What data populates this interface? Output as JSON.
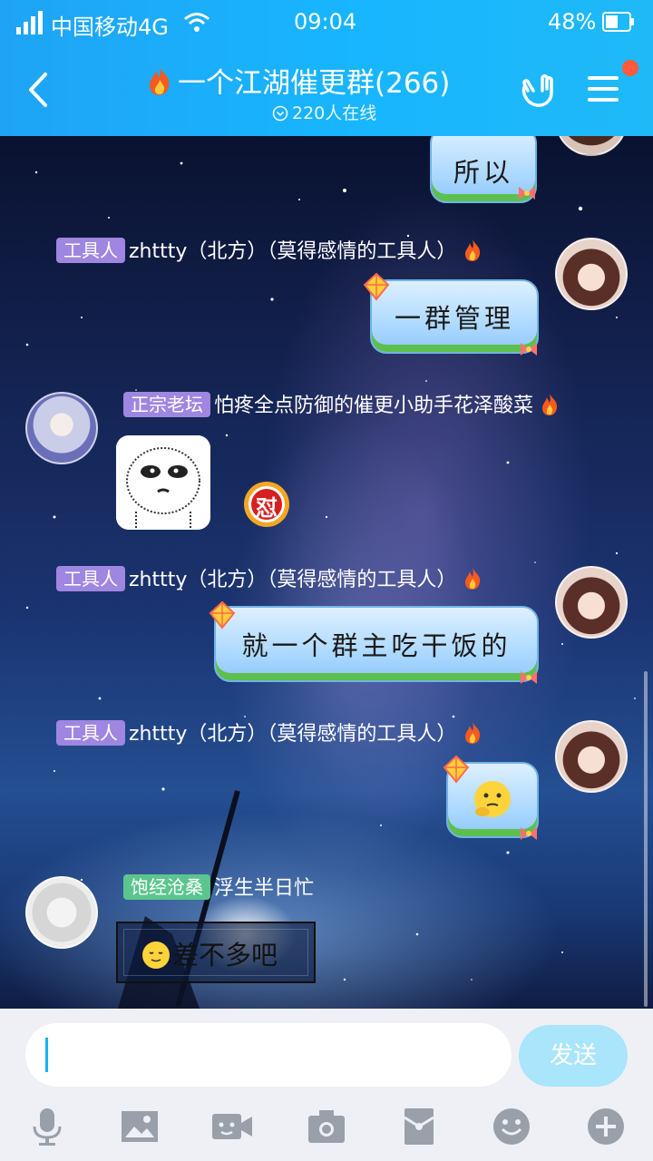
{
  "status_bar": {
    "carrier": "中国移动4G",
    "time": "09:04",
    "battery": "48%"
  },
  "header": {
    "title": "一个江湖催更群(266)",
    "online": "220人在线"
  },
  "messages": {
    "m0_text": "所以",
    "m1": {
      "tag": "工具人",
      "nick": "zhttty（北方）（莫得感情的工具人）",
      "text": "一群管理"
    },
    "m2": {
      "tag": "正宗老坛",
      "nick": "怕疼全点防御的催更小助手花泽酸菜",
      "badge": "怼"
    },
    "m3": {
      "tag": "工具人",
      "nick": "zhttty（北方）（莫得感情的工具人）",
      "text": "就一个群主吃干饭的"
    },
    "m4": {
      "tag": "工具人",
      "nick": "zhttty（北方）（莫得感情的工具人）"
    },
    "m5": {
      "tag": "饱经沧桑",
      "nick": "浮生半日忙",
      "text": "差不多吧"
    }
  },
  "input": {
    "send_label": "发送",
    "value": ""
  },
  "toolbar": [
    "mic-icon",
    "image-icon",
    "video-call-icon",
    "camera-icon",
    "red-packet-icon",
    "emoji-icon",
    "plus-icon"
  ],
  "colors": {
    "header": "#18b6ff",
    "tag_purple": "#9f86e0",
    "tag_green": "#5bc58e",
    "send_button": "#a9e5fb",
    "notification_dot": "#ff5a3c"
  }
}
